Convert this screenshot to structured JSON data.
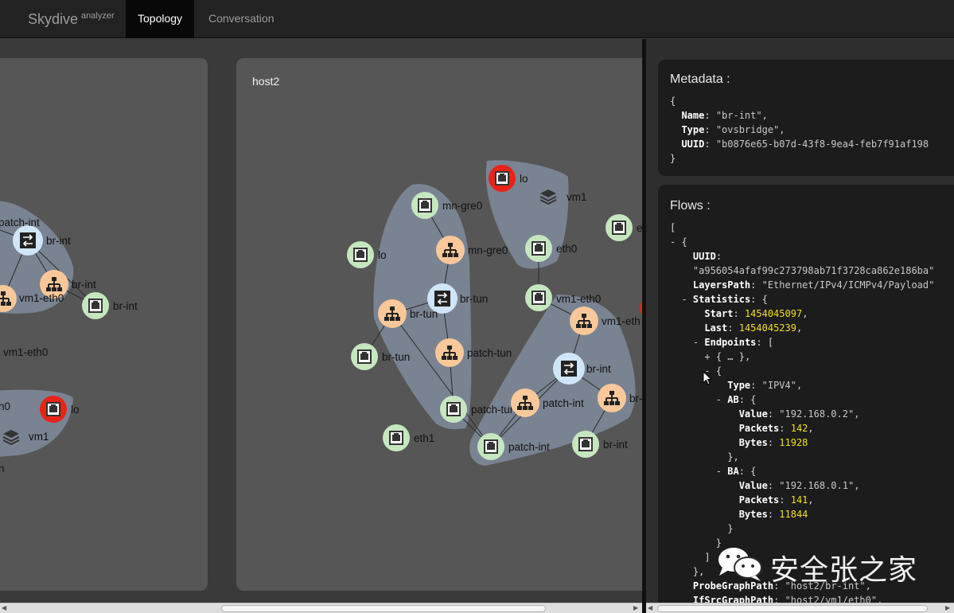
{
  "navbar": {
    "brand": "Skydive",
    "brand_sub": "analyzer",
    "tabs": [
      {
        "label": "Topology",
        "active": true
      },
      {
        "label": "Conversation",
        "active": false
      }
    ]
  },
  "topology": {
    "host1_labels": {
      "patch_int": "patch-int",
      "br_int_a": "br-int",
      "br_int_b": "br-int",
      "br_int_c": "br-int",
      "vm1_eth0_a": "vm1-eth0",
      "vm1_eth0_b": "vm1-eth0",
      "eth0_trunc": "h0",
      "lo": "lo",
      "vm1": "vm1",
      "trunc_n": "n"
    },
    "host2": {
      "title": "host2",
      "labels": {
        "mn_gre0_a": "mn-gre0",
        "mn_gre0_b": "mn-gre0",
        "lo_a": "lo",
        "br_tun_a": "br-tun",
        "br_tun_b": "br-tun",
        "br_tun_c": "br-tun",
        "patch_tun_a": "patch-tun",
        "patch_tun_b": "patch-tun",
        "eth1": "eth1",
        "lo_b": "lo",
        "vm1": "vm1",
        "eth0": "eth0",
        "vm1_eth0_a": "vm1-eth0",
        "vm1_eth0_b": "vm1-eth",
        "br_int_a": "br-int",
        "patch_int_a": "patch-int",
        "patch_int_b": "patch-int",
        "br_int_b": "br-int",
        "br_trunc": "br-",
        "e_trunc": "e"
      }
    },
    "colors": {
      "interface": "#c6e6c0",
      "port": "#f9c89a",
      "bridge": "#d0e6f8",
      "down": "#e8231a",
      "group": "#7a8392"
    }
  },
  "metadata": {
    "title": "Metadata :",
    "open": "{",
    "close": "}",
    "fields": [
      {
        "key": "Name",
        "value": "\"br-int\","
      },
      {
        "key": "Type",
        "value": "\"ovsbridge\","
      },
      {
        "key": "UUID",
        "value": "\"b0876e65-b07d-43f8-9ea4-feb7f91af198"
      }
    ]
  },
  "flows": {
    "title": "Flows :",
    "uuid_key": "UUID",
    "uuid_value": "\"a956054afaf99c273798ab71f3728ca862e186ba\"",
    "layers_key": "LayersPath",
    "layers_value": "\"Ethernet/IPv4/ICMPv4/Payload\"",
    "statistics_key": "Statistics",
    "start_key": "Start",
    "start_value": "1454045097",
    "last_key": "Last",
    "last_value": "1454045239",
    "endpoints_key": "Endpoints",
    "collapsed": "{ … },",
    "type_key": "Type",
    "type_value": "\"IPV4\",",
    "ab_key": "AB",
    "ab_value_key": "Value",
    "ab_value": "\"192.168.0.2\",",
    "ab_packets_key": "Packets",
    "ab_packets": "142",
    "ab_bytes_key": "Bytes",
    "ab_bytes": "11928",
    "ba_key": "BA",
    "ba_value_key": "Value",
    "ba_value": "\"192.168.0.1\",",
    "ba_packets_key": "Packets",
    "ba_packets": "141",
    "ba_bytes_key": "Bytes",
    "ba_bytes": "11844",
    "probe_key": "ProbeGraphPath",
    "probe_value": "\"host2/br-int\",",
    "ifsrc_key": "IfSrcGraphPath",
    "ifsrc_value": "\"host2/vm1/eth0\","
  },
  "watermark": {
    "text": "安全张之家",
    "icon": "wechat-icon"
  }
}
